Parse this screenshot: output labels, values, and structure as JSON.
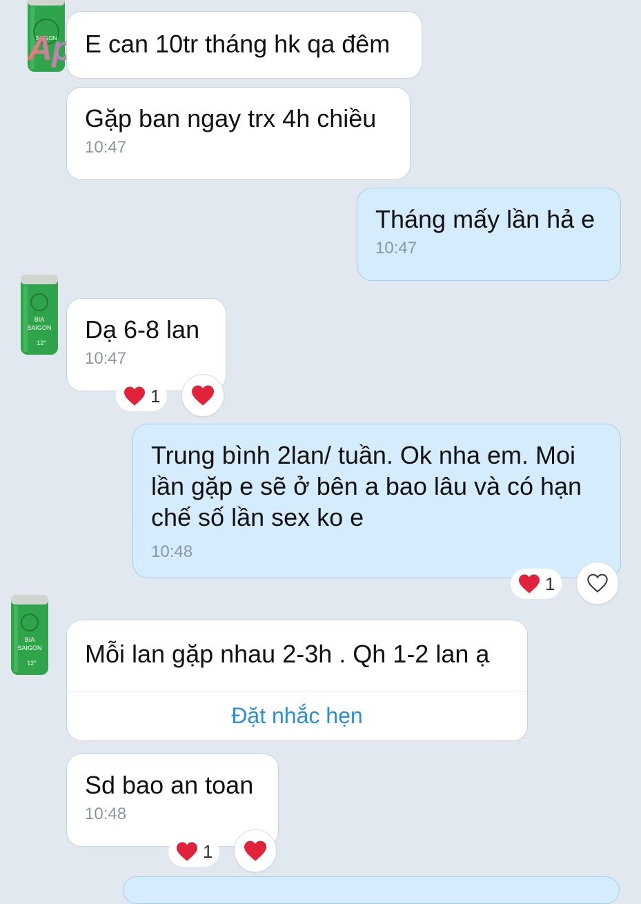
{
  "messages": [
    {
      "id": "m1",
      "text": "E can 10tr tháng hk qa đêm"
    },
    {
      "id": "m2",
      "text": "Gặp ban ngay trx 4h chiều",
      "time": "10:47"
    },
    {
      "id": "m3",
      "text": "Tháng mấy lần hả e",
      "time": "10:47"
    },
    {
      "id": "m4",
      "text": "Dạ 6-8 lan",
      "time": "10:47",
      "reaction_count": "1"
    },
    {
      "id": "m5",
      "text": "Trung bình 2lan/ tuần. Ok nha em. Moi\nlần gặp e sẽ ở bên a bao lâu và có hạn\nchế số lần sex ko e",
      "time": "10:48",
      "reaction_count": "1"
    },
    {
      "id": "m6",
      "text": "Mỗi lan gặp nhau 2-3h . Qh 1-2 lan ạ",
      "action_label": "Đặt nhắc hẹn"
    },
    {
      "id": "m7",
      "text": "Sd bao an toan",
      "time": "10:48",
      "reaction_count": "1"
    }
  ],
  "avatar": {
    "line1": "BIA",
    "line2": "SAIGON",
    "line3": "12°"
  },
  "watermark": "Aphangx",
  "colors": {
    "background": "#e2e8f0",
    "incoming_bubble": "#ffffff",
    "outgoing_bubble": "#d4ecfb",
    "heart": "#e0233a",
    "link": "#2a8fd6",
    "avatar_can": "#2fa44a"
  },
  "icons": {
    "reaction": "heart-icon",
    "react_button_empty": "heart-outline-icon"
  }
}
